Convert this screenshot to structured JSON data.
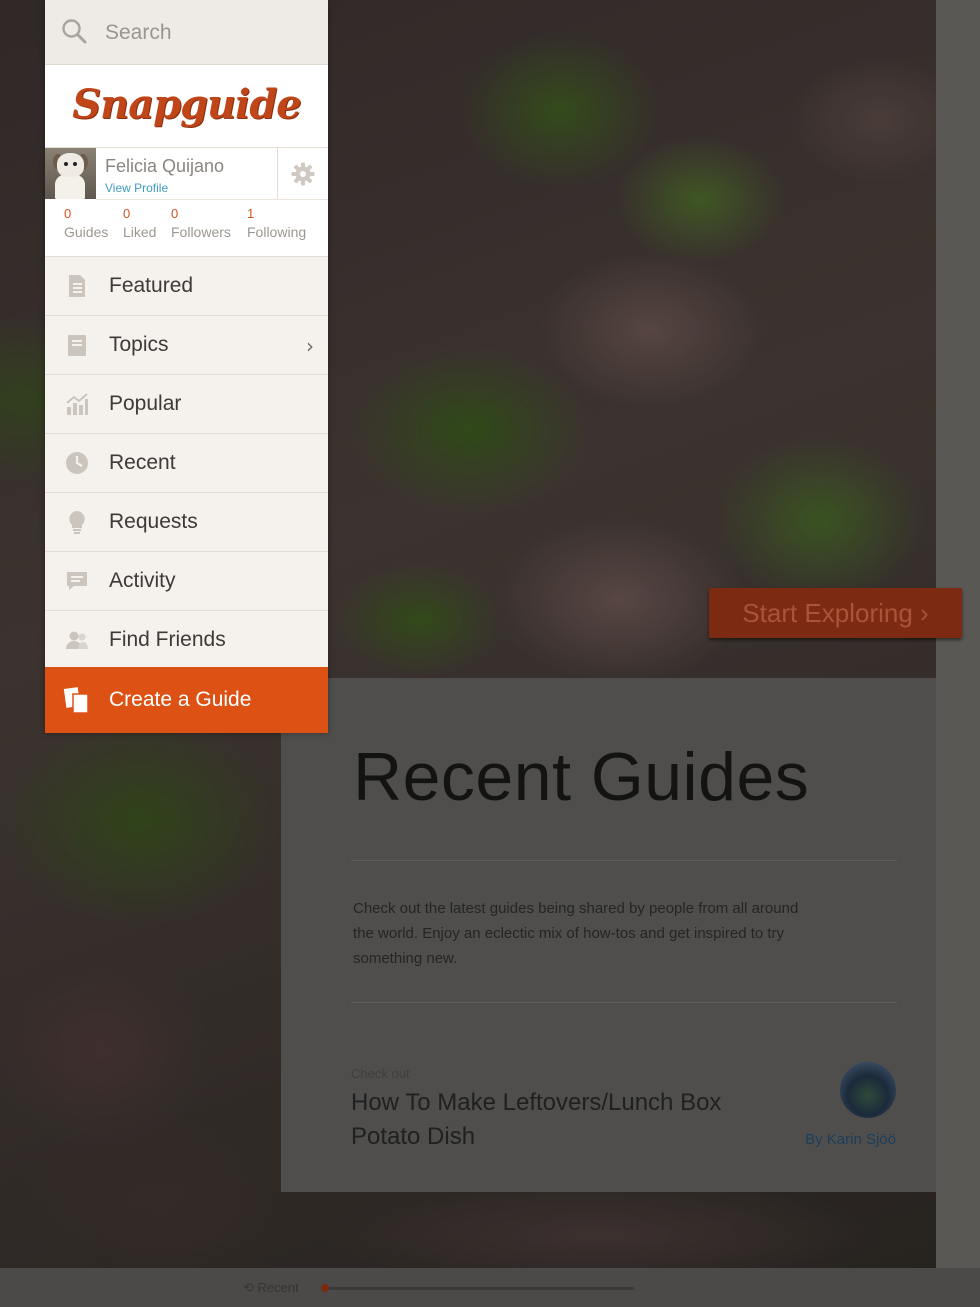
{
  "search": {
    "placeholder": "Search"
  },
  "brand": {
    "logo_text": "Snapguide",
    "accent": "#dd5214"
  },
  "profile": {
    "name": "Felicia Quijano",
    "view_profile": "View Profile",
    "stats": [
      {
        "value": "0",
        "label": "Guides"
      },
      {
        "value": "0",
        "label": "Liked"
      },
      {
        "value": "0",
        "label": "Followers"
      },
      {
        "value": "1",
        "label": "Following"
      }
    ]
  },
  "menu": {
    "items": [
      {
        "label": "Featured",
        "icon": "document-icon"
      },
      {
        "label": "Topics",
        "icon": "book-icon",
        "chevron": "›"
      },
      {
        "label": "Popular",
        "icon": "chart-icon"
      },
      {
        "label": "Recent",
        "icon": "clock-icon"
      },
      {
        "label": "Requests",
        "icon": "lightbulb-icon"
      },
      {
        "label": "Activity",
        "icon": "chat-icon"
      },
      {
        "label": "Find Friends",
        "icon": "people-icon"
      }
    ],
    "create": {
      "label": "Create a Guide",
      "icon": "copy-icon"
    }
  },
  "hero": {
    "start_button": "Start Exploring ›"
  },
  "recent": {
    "title": "Recent Guides",
    "description": "Check out the latest guides being shared by people from all around the world. Enjoy an eclectic mix of how-tos and get inspired to try something new.",
    "check_out": "Check out",
    "guide_title": "How To Make Leftovers/Lunch Box Potato Dish",
    "author": "By Karin Sjöö"
  },
  "bottom": {
    "label": "Recent"
  }
}
